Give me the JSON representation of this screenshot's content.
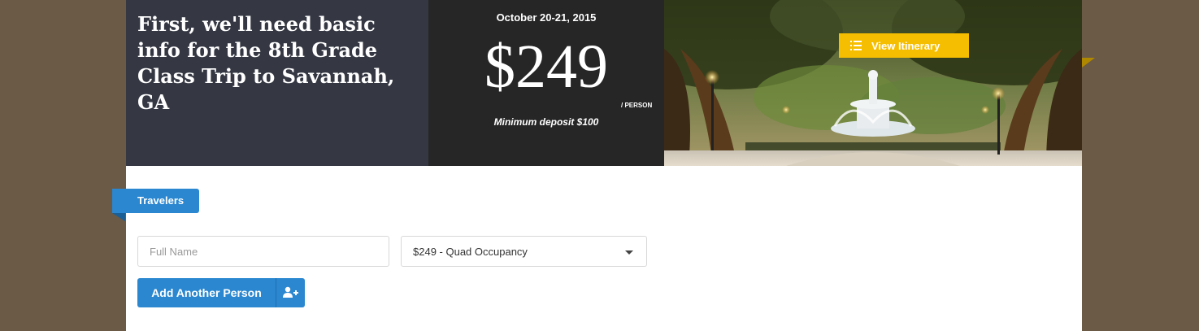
{
  "hero": {
    "title": "First, we'll need basic info for the 8th Grade Class Trip to Savannah, GA",
    "date": "October 20-21, 2015",
    "price": "$249",
    "per_person": "/ PERSON",
    "deposit": "Minimum deposit $100",
    "itinerary_button": "View Itinerary"
  },
  "travelers": {
    "tag": "Travelers",
    "name_placeholder": "Full Name",
    "name_value": "",
    "occupancy_selected": "$249 - Quad Occupancy",
    "add_button": "Add Another Person"
  },
  "colors": {
    "background": "#6b5a46",
    "title_panel": "#353843",
    "price_panel": "#262626",
    "accent_blue": "#2a87d0",
    "accent_yellow": "#f6be00"
  },
  "icons": {
    "itinerary": "list-icon",
    "add_person": "add-user-icon",
    "dropdown": "chevron-down-icon"
  }
}
